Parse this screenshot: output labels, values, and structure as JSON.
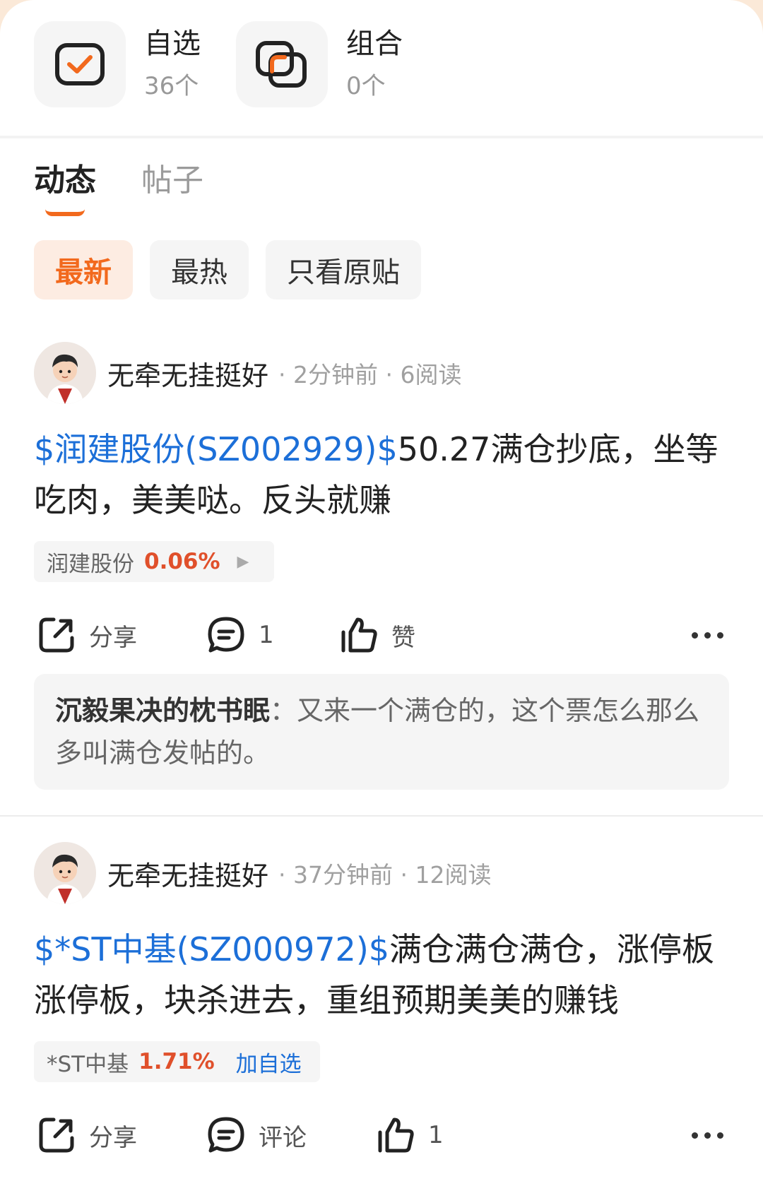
{
  "quick_cards": [
    {
      "title": "自选",
      "count": "36个",
      "icon": "checkbox-icon"
    },
    {
      "title": "组合",
      "count": "0个",
      "icon": "portfolio-squares-icon"
    }
  ],
  "tabs": {
    "active": "动态",
    "inactive": "帖子"
  },
  "filters": [
    "最新",
    "最热",
    "只看原贴"
  ],
  "colors": {
    "accent": "#f2691d",
    "link": "#1c6fd8",
    "rise": "#e0502b"
  },
  "posts": [
    {
      "author": "无牵无挂挺好",
      "meta": "· 2分钟前 · 6阅读",
      "stock_link": "$润建股份(SZ002929)$",
      "text": "50.27满仓抄底，坐等吃肉，美美哒。反头就赚",
      "stock_chip": {
        "name": "润建股份",
        "pct": "0.06%"
      },
      "actions": {
        "share": "分享",
        "comment": "1",
        "like": "赞"
      },
      "comment": {
        "author": "沉毅果决的枕书眠",
        "sep": "：",
        "text": "又来一个满仓的，这个票怎么那么多叫满仓发帖的。"
      }
    },
    {
      "author": "无牵无挂挺好",
      "meta": "· 37分钟前 · 12阅读",
      "stock_link": "$*ST中基(SZ000972)$",
      "text": "满仓满仓满仓，涨停板涨停板，块杀进去，重组预期美美的赚钱",
      "stock_chip": {
        "name": "*ST中基",
        "pct": "1.71%",
        "add": "加自选"
      },
      "actions": {
        "share": "分享",
        "comment": "评论",
        "like": "1"
      }
    }
  ]
}
